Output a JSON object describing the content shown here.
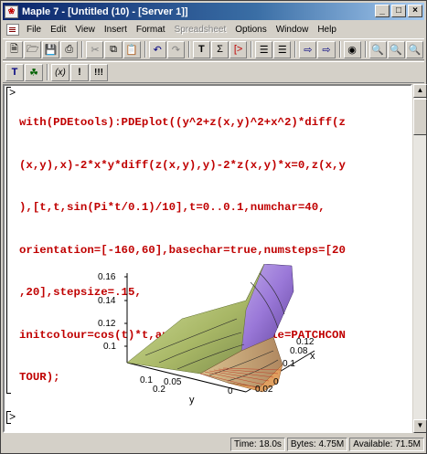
{
  "window": {
    "title": "Maple 7 - [Untitled (10) - [Server 1]]"
  },
  "menu": {
    "items": [
      {
        "label": "File",
        "disabled": false
      },
      {
        "label": "Edit",
        "disabled": false
      },
      {
        "label": "View",
        "disabled": false
      },
      {
        "label": "Insert",
        "disabled": false
      },
      {
        "label": "Format",
        "disabled": false
      },
      {
        "label": "Spreadsheet",
        "disabled": true
      },
      {
        "label": "Options",
        "disabled": false
      },
      {
        "label": "Window",
        "disabled": false
      },
      {
        "label": "Help",
        "disabled": false
      }
    ]
  },
  "toolbar2": {
    "tool_texts": [
      "(x)",
      "!",
      "!!!"
    ]
  },
  "document": {
    "prompt": ">",
    "code_lines": [
      "with(PDEtools):PDEplot((y^2+z(x,y)^2+x^2)*diff(z",
      "(x,y),x)-2*x*y*diff(z(x,y),y)-2*z(x,y)*x=0,z(x,y",
      "),[t,t,sin(Pi*t/0.1)/10],t=0..0.1,numchar=40,",
      "orientation=[-160,60],basechar=true,numsteps=[20",
      ",20],stepsize=.15,",
      "initcolour=cos(t)*t,animate=false,style=PATCHCON",
      "TOUR);"
    ],
    "empty_prompt": "[>"
  },
  "plot": {
    "z_ticks": [
      "0.16",
      "0.14",
      "0.12",
      "0.1"
    ],
    "y_ticks": [
      "0.1",
      "0.05",
      "0.2",
      "0.1",
      "0"
    ],
    "y_label": "y",
    "x_ticks": [
      "0.1",
      "0.08",
      "0.12",
      "0.1",
      "0.04",
      "0.02",
      "0"
    ],
    "x_label": "x"
  },
  "status": {
    "time": "Time: 18.0s",
    "bytes": "Bytes: 4.75M",
    "available": "Available: 71.5M"
  }
}
